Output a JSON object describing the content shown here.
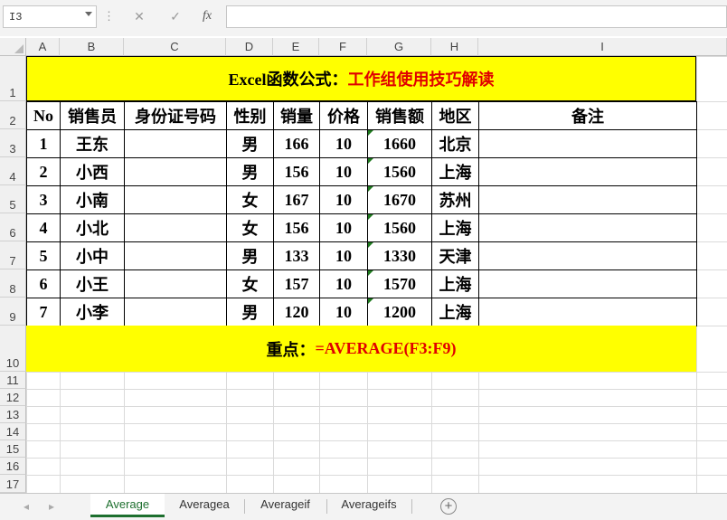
{
  "formula_bar": {
    "name_box": "I3",
    "cancel_icon": "✕",
    "enter_icon": "✓",
    "fx_label": "fx",
    "formula": ""
  },
  "columns": [
    "A",
    "B",
    "C",
    "D",
    "E",
    "F",
    "G",
    "H",
    "I"
  ],
  "rows": [
    "1",
    "2",
    "3",
    "4",
    "5",
    "6",
    "7",
    "8",
    "9",
    "10",
    "11",
    "12",
    "13",
    "14",
    "15",
    "16",
    "17"
  ],
  "title": {
    "prefix": "Excel函数公式：",
    "highlight": "工作组使用技巧解读"
  },
  "table": {
    "headers": [
      "No",
      "销售员",
      "身份证号码",
      "性别",
      "销量",
      "价格",
      "销售额",
      "地区",
      "备注"
    ],
    "rows": [
      [
        "1",
        "王东",
        "",
        "男",
        "166",
        "10",
        "1660",
        "北京",
        ""
      ],
      [
        "2",
        "小西",
        "",
        "男",
        "156",
        "10",
        "1560",
        "上海",
        ""
      ],
      [
        "3",
        "小南",
        "",
        "女",
        "167",
        "10",
        "1670",
        "苏州",
        ""
      ],
      [
        "4",
        "小北",
        "",
        "女",
        "156",
        "10",
        "1560",
        "上海",
        ""
      ],
      [
        "5",
        "小中",
        "",
        "男",
        "133",
        "10",
        "1330",
        "天津",
        ""
      ],
      [
        "6",
        "小王",
        "",
        "女",
        "157",
        "10",
        "1570",
        "上海",
        ""
      ],
      [
        "7",
        "小李",
        "",
        "男",
        "120",
        "10",
        "1200",
        "上海",
        ""
      ]
    ]
  },
  "footer": {
    "prefix": "重点：",
    "formula": "=AVERAGE(F3:F9)"
  },
  "sheet_tabs": [
    "Average",
    "Averagea",
    "Averageif",
    "Averageifs"
  ],
  "active_tab": "Average",
  "nav": {
    "prev": "◂",
    "next": "▸",
    "add": "+"
  },
  "colors": {
    "header_fill": "#ffff00",
    "accent_red": "#e00000",
    "tab_green": "#1d6f2e"
  }
}
